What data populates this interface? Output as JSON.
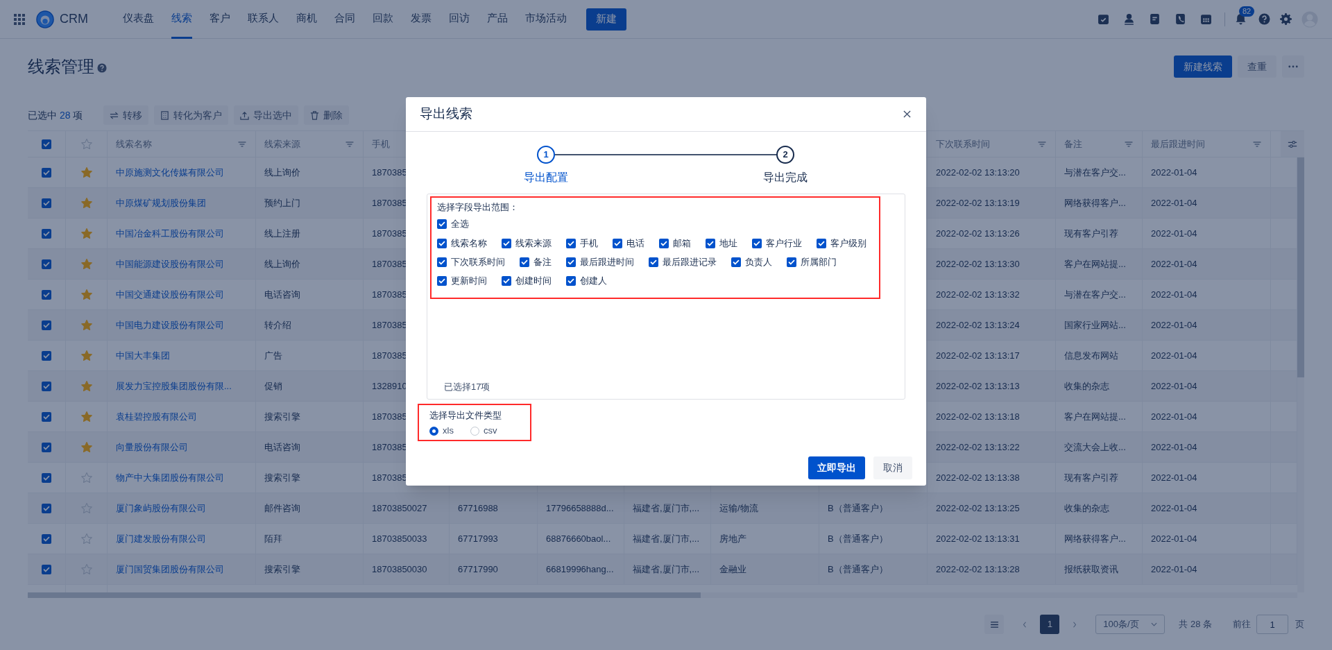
{
  "nav": {
    "logo": "CRM",
    "items": [
      {
        "label": "仪表盘",
        "selected": false
      },
      {
        "label": "线索",
        "selected": true
      },
      {
        "label": "客户",
        "selected": false
      },
      {
        "label": "联系人",
        "selected": false
      },
      {
        "label": "商机",
        "selected": false
      },
      {
        "label": "合同",
        "selected": false
      },
      {
        "label": "回款",
        "selected": false
      },
      {
        "label": "发票",
        "selected": false
      },
      {
        "label": "回访",
        "selected": false
      },
      {
        "label": "产品",
        "selected": false
      },
      {
        "label": "市场活动",
        "selected": false
      }
    ],
    "create_button": "新建",
    "notification_count": "82"
  },
  "page": {
    "title": "线索管理",
    "primary_action": "新建线索",
    "secondary_action": "查重"
  },
  "toolbar": {
    "selected_prefix": "已选中",
    "selected_count": "28",
    "selected_suffix": "项",
    "actions": [
      "转移",
      "转化为客户",
      "导出选中",
      "删除"
    ]
  },
  "table": {
    "all_checked": true,
    "columns": [
      {
        "label": "线索名称",
        "filter": true
      },
      {
        "label": "线索来源",
        "filter": true
      },
      {
        "label": "手机",
        "filter": false
      },
      null,
      null,
      null,
      null,
      null,
      {
        "label": "下次联系时间",
        "filter": true
      },
      {
        "label": "备注",
        "filter": true
      },
      {
        "label": "最后跟进时间",
        "filter": true
      }
    ],
    "rows": [
      {
        "checked": true,
        "starred": true,
        "cells": [
          "中原施测文化传媒有限公司",
          "线上询价",
          "1870385",
          null,
          null,
          null,
          null,
          null,
          "2022-02-02 13:13:20",
          "与潜在客户交...",
          "2022-01-04"
        ]
      },
      {
        "checked": true,
        "starred": true,
        "cells": [
          "中原煤矿规划股份集团",
          "预约上门",
          "1870385",
          null,
          null,
          null,
          null,
          null,
          "2022-02-02 13:13:19",
          "网络获得客户...",
          "2022-01-04"
        ]
      },
      {
        "checked": true,
        "starred": true,
        "cells": [
          "中国冶金科工股份有限公司",
          "线上注册",
          "1870385",
          null,
          null,
          null,
          null,
          null,
          "2022-02-02 13:13:26",
          "现有客户引荐",
          "2022-01-04"
        ]
      },
      {
        "checked": true,
        "starred": true,
        "cells": [
          "中国能源建设股份有限公司",
          "线上询价",
          "1870385",
          null,
          null,
          null,
          null,
          null,
          "2022-02-02 13:13:30",
          "客户在网站提...",
          "2022-01-04"
        ]
      },
      {
        "checked": true,
        "starred": true,
        "cells": [
          "中国交通建设股份有限公司",
          "电话咨询",
          "1870385",
          null,
          null,
          null,
          null,
          null,
          "2022-02-02 13:13:32",
          "与潜在客户交...",
          "2022-01-04"
        ]
      },
      {
        "checked": true,
        "starred": true,
        "cells": [
          "中国电力建设股份有限公司",
          "转介绍",
          "1870385",
          null,
          null,
          null,
          null,
          null,
          "2022-02-02 13:13:24",
          "国家行业网站...",
          "2022-01-04"
        ]
      },
      {
        "checked": true,
        "starred": true,
        "cells": [
          "中国大丰集团",
          "广告",
          "1870385",
          null,
          null,
          null,
          null,
          null,
          "2022-02-02 13:13:17",
          "信息发布网站",
          "2022-01-04"
        ]
      },
      {
        "checked": true,
        "starred": true,
        "cells": [
          "展发力宝控股集团股份有限...",
          "促销",
          "1328910",
          null,
          null,
          null,
          null,
          null,
          "2022-02-02 13:13:13",
          "收集的杂志",
          "2022-01-04"
        ]
      },
      {
        "checked": true,
        "starred": true,
        "cells": [
          "袁桂碧控股有限公司",
          "搜索引擎",
          "1870385",
          null,
          null,
          null,
          null,
          null,
          "2022-02-02 13:13:18",
          "客户在网站提...",
          "2022-01-04"
        ]
      },
      {
        "checked": true,
        "starred": true,
        "cells": [
          "向量股份有限公司",
          "电话咨询",
          "1870385",
          null,
          null,
          null,
          null,
          null,
          "2022-02-02 13:13:22",
          "交流大会上收...",
          "2022-01-04"
        ]
      },
      {
        "checked": true,
        "starred": false,
        "cells": [
          "物产中大集团股份有限公司",
          "搜索引擎",
          "1870385",
          null,
          null,
          null,
          null,
          null,
          "2022-02-02 13:13:38",
          "现有客户引荐",
          "2022-01-04"
        ]
      },
      {
        "checked": true,
        "starred": false,
        "cells": [
          "厦门象屿股份有限公司",
          "邮件咨询",
          "18703850027",
          "67716988",
          "17796658888d...",
          "福建省,厦门市,...",
          "运输/物流",
          "B（普通客户）",
          "2022-02-02 13:13:25",
          "收集的杂志",
          "2022-01-04"
        ]
      },
      {
        "checked": true,
        "starred": false,
        "cells": [
          "厦门建发股份有限公司",
          "陌拜",
          "18703850033",
          "67717993",
          "68876660baol...",
          "福建省,厦门市,...",
          "房地产",
          "B（普通客户）",
          "2022-02-02 13:13:31",
          "网络获得客户...",
          "2022-01-04"
        ]
      },
      {
        "checked": true,
        "starred": false,
        "cells": [
          "厦门国贸集团股份有限公司",
          "搜索引擎",
          "18703850030",
          "67717990",
          "66819996hang...",
          "福建省,厦门市,...",
          "金融业",
          "B（普通客户）",
          "2022-02-02 13:13:28",
          "报纸获取资讯",
          "2022-01-04"
        ]
      }
    ]
  },
  "dialog": {
    "title": "导出线索",
    "steps": [
      {
        "number": "1",
        "label": "导出配置",
        "selected": true
      },
      {
        "number": "2",
        "label": "导出完成",
        "selected": false
      }
    ],
    "field_section": {
      "title": "选择字段导出范围：",
      "highlighted": true,
      "select_all": {
        "label": "全选",
        "checked": true
      },
      "fields": [
        {
          "label": "线索名称",
          "checked": true
        },
        {
          "label": "线索来源",
          "checked": true
        },
        {
          "label": "手机",
          "checked": true
        },
        {
          "label": "电话",
          "checked": true
        },
        {
          "label": "邮箱",
          "checked": true
        },
        {
          "label": "地址",
          "checked": true
        },
        {
          "label": "客户行业",
          "checked": true
        },
        {
          "label": "客户级别",
          "checked": true
        },
        {
          "label": "下次联系时间",
          "checked": true
        },
        {
          "label": "备注",
          "checked": true
        },
        {
          "label": "最后跟进时间",
          "checked": true
        },
        {
          "label": "最后跟进记录",
          "checked": true
        },
        {
          "label": "负责人",
          "checked": true
        },
        {
          "label": "所属部门",
          "checked": true
        },
        {
          "label": "更新时间",
          "checked": true
        },
        {
          "label": "创建时间",
          "checked": true
        },
        {
          "label": "创建人",
          "checked": true
        }
      ],
      "summary": "已选择17项"
    },
    "file_type": {
      "title": "选择导出文件类型",
      "highlighted": true,
      "options": [
        {
          "label": "xls",
          "selected": true
        },
        {
          "label": "csv",
          "selected": false
        }
      ]
    },
    "primary_button": "立即导出",
    "cancel_button": "取消"
  },
  "pagination": {
    "pages": [
      {
        "label": "1",
        "selected": true
      }
    ],
    "page_size": "100条/页",
    "total": "共 28 条",
    "goto_label": "前往",
    "goto_value": "1",
    "goto_suffix": "页"
  }
}
